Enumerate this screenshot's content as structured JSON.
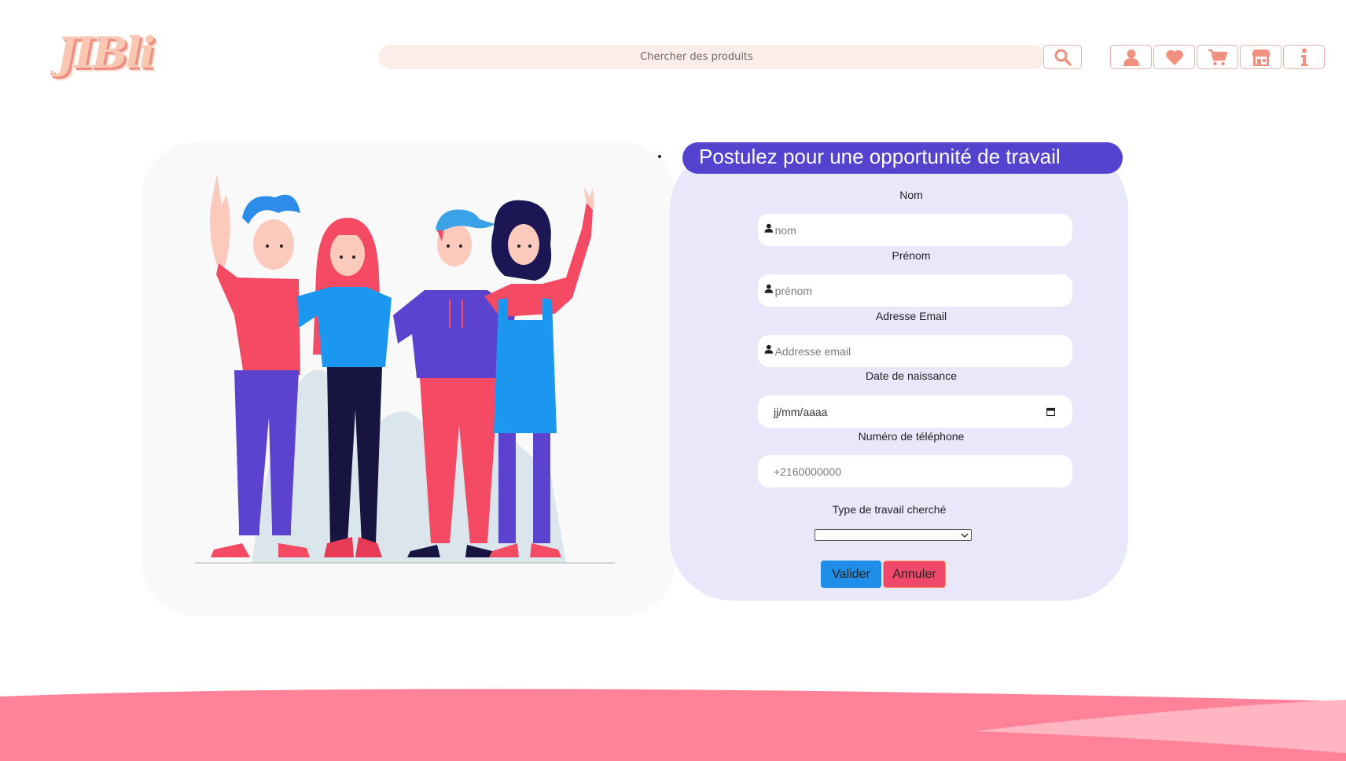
{
  "header": {
    "logo_text": "JIBli",
    "search_placeholder": "Chercher des produits",
    "icons": [
      "search-icon",
      "user-icon",
      "heart-icon",
      "cart-icon",
      "store-icon",
      "info-icon"
    ]
  },
  "form": {
    "title": "Postulez pour une opportunité de travail",
    "nom_label": "Nom",
    "nom_placeholder": "nom",
    "prenom_label": "Prénom",
    "prenom_placeholder": "prénom",
    "email_label": "Adresse Email",
    "email_placeholder": "Addresse email",
    "dob_label": "Date de naissance",
    "dob_value": "jj/mm/aaaa",
    "phone_label": "Numéro de téléphone",
    "phone_placeholder": "+2160000000",
    "type_label": "Type de travail cherché",
    "type_value": "",
    "submit_label": "Valider",
    "cancel_label": "Annuler"
  },
  "colors": {
    "accent": "#f0917f",
    "title_bg": "#5542cf",
    "form_bg": "#e9e8fb",
    "submit_bg": "#1f8ee8",
    "cancel_bg": "#f0486a",
    "footer_wave": "#ff8299"
  }
}
